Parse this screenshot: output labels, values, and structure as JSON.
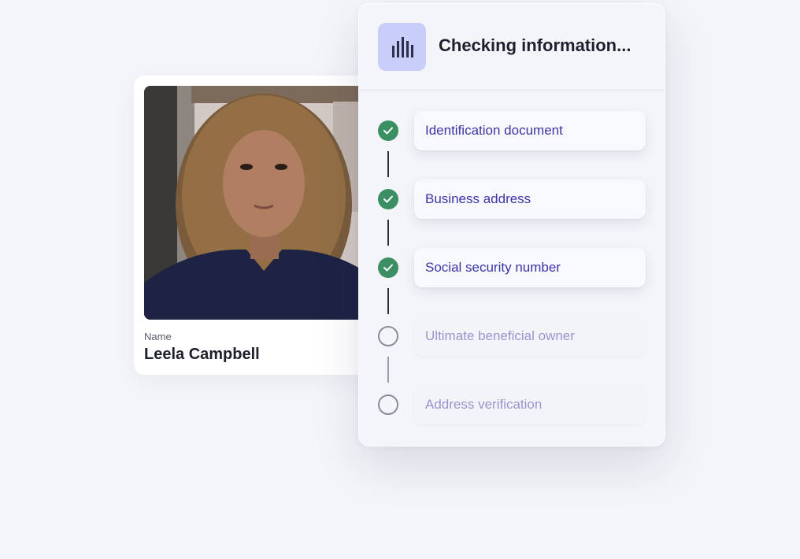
{
  "profile": {
    "photo_alt": "Portrait photo",
    "name_label": "Name",
    "name_value": "Leela Campbell"
  },
  "panel": {
    "header_icon": "building-icon",
    "title": "Checking information..."
  },
  "steps": [
    {
      "label": "Identification document",
      "status": "complete"
    },
    {
      "label": "Business address",
      "status": "complete"
    },
    {
      "label": "Social security number",
      "status": "complete"
    },
    {
      "label": "Ultimate beneficial owner",
      "status": "pending"
    },
    {
      "label": "Address verification",
      "status": "pending"
    }
  ],
  "colors": {
    "background": "#f4f5f9",
    "check_green": "#3b8f63",
    "label_purple": "#3b35a8",
    "label_pending": "#9a93cf",
    "icon_box": "#c8cdfa"
  }
}
